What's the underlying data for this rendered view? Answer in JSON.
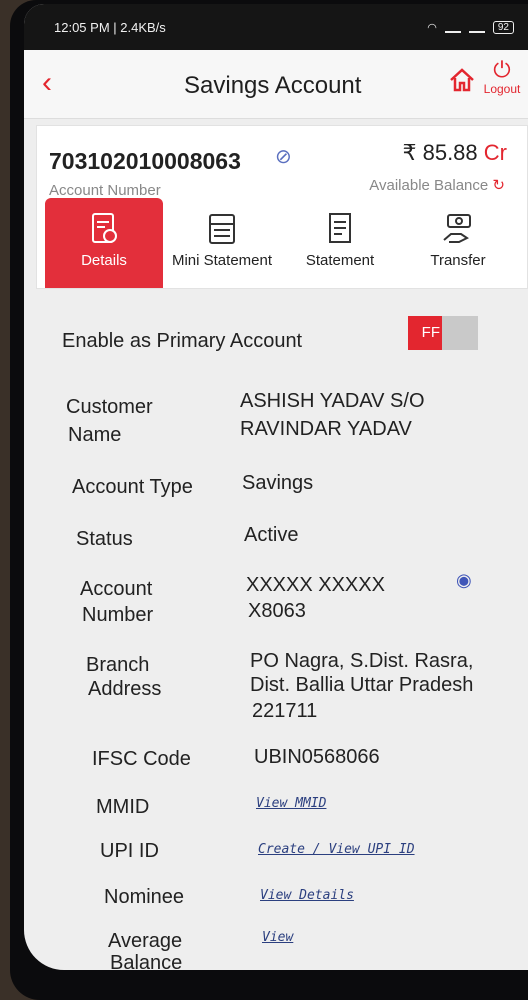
{
  "status_bar": {
    "time": "12:05 PM | 2.4KB/s",
    "battery": "92"
  },
  "header": {
    "title": "Savings Account",
    "logout_label": "Logout"
  },
  "account_card": {
    "account_number": "703102010008063",
    "account_number_label": "Account Number",
    "balance": "₹ 85.88",
    "balance_unit": "Cr",
    "balance_label": "Available Balance"
  },
  "tabs": [
    {
      "label": "Details",
      "icon": "details-icon"
    },
    {
      "label": "Mini Statement",
      "icon": "calculator-icon"
    },
    {
      "label": "Statement",
      "icon": "document-icon"
    },
    {
      "label": "Transfer",
      "icon": "money-hand-icon"
    }
  ],
  "primary": {
    "label": "Enable as Primary Account",
    "toggle_text": "FF"
  },
  "details": {
    "customer_name_label_1": "Customer",
    "customer_name_label_2": "Name",
    "customer_name_1": "ASHISH YADAV S/O",
    "customer_name_2": "RAVINDAR YADAV",
    "account_type_label": "Account Type",
    "account_type": "Savings",
    "status_label": "Status",
    "status": "Active",
    "account_number_label_1": "Account",
    "account_number_label_2": "Number",
    "account_number_1": "XXXXX XXXXX",
    "account_number_2": "X8063",
    "branch_label_1": "Branch",
    "branch_label_2": "Address",
    "branch_1": "PO Nagra, S.Dist. Rasra,",
    "branch_2": "Dist. Ballia Uttar Pradesh",
    "branch_3": "221711",
    "ifsc_label": "IFSC Code",
    "ifsc": "UBIN0568066",
    "mmid_label": "MMID",
    "mmid_link": "View MMID",
    "upi_label": "UPI ID",
    "upi_link": "Create / View UPI ID",
    "nominee_label": "Nominee",
    "nominee_link": "View Details",
    "avg_label_1": "Average",
    "avg_label_2": "Balance",
    "avg_link": "View"
  }
}
